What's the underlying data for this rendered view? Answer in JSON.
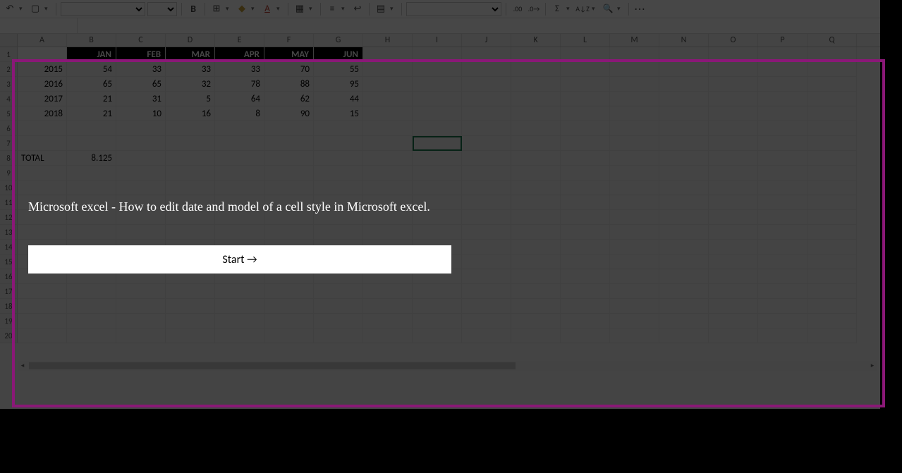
{
  "toolbar": {
    "undo_icon": "↶",
    "paste_icon": "▢",
    "bold_label": "B",
    "border_icon": "⊞",
    "fill_icon": "◆",
    "font_color_icon": "A",
    "merge_icon": "▦",
    "align_icon": "≡",
    "wrap_icon": "↩",
    "conditional_icon": "▤",
    "decimal_inc": ".00",
    "decimal_dec": ".0→",
    "sum_icon": "Σ",
    "sort_icon": "A↓Z",
    "find_icon": "🔍",
    "more_icon": "⋯"
  },
  "columns": [
    "A",
    "B",
    "C",
    "D",
    "E",
    "F",
    "G",
    "H",
    "I",
    "J",
    "K",
    "L",
    "M",
    "N",
    "O",
    "P",
    "Q"
  ],
  "row_numbers": [
    "1",
    "2",
    "3",
    "4",
    "5",
    "6",
    "7",
    "8",
    "9",
    "10",
    "11",
    "12",
    "13",
    "14",
    "15",
    "16",
    "17",
    "18",
    "19",
    "20"
  ],
  "chart_data": {
    "type": "table",
    "months": [
      "JAN",
      "FEB",
      "MAR",
      "APR",
      "MAY",
      "JUN"
    ],
    "rows": [
      {
        "year": "2015",
        "values": [
          "54",
          "33",
          "33",
          "33",
          "70",
          "55"
        ]
      },
      {
        "year": "2016",
        "values": [
          "65",
          "65",
          "32",
          "78",
          "88",
          "95"
        ]
      },
      {
        "year": "2017",
        "values": [
          "21",
          "31",
          "5",
          "64",
          "62",
          "44"
        ]
      },
      {
        "year": "2018",
        "values": [
          "21",
          "10",
          "16",
          "8",
          "90",
          "15"
        ]
      }
    ],
    "total_label": "TOTAL",
    "total_value": "8.125"
  },
  "tutorial": {
    "title": "Microsoft excel - How to edit date and model of a cell style in Microsoft excel.",
    "start_label": "Start →"
  }
}
